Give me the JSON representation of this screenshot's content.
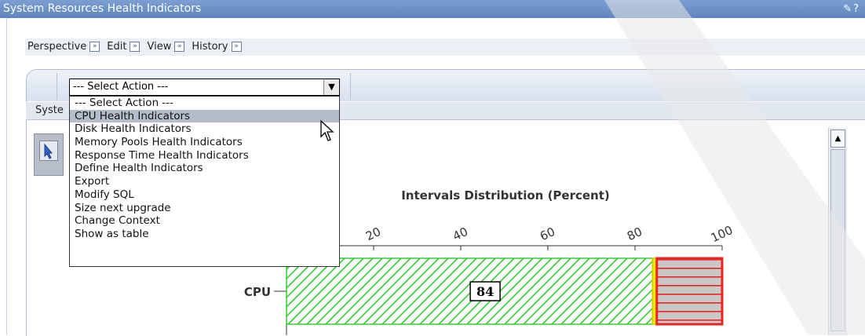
{
  "window": {
    "title": "System Resources Health Indicators",
    "edit_icon": "pencil-icon",
    "help_icon": "question-icon"
  },
  "menubar": {
    "items": [
      {
        "label": "Perspective"
      },
      {
        "label": "Edit"
      },
      {
        "label": "View"
      },
      {
        "label": "History"
      }
    ]
  },
  "action_select": {
    "value": "--- Select Action ---"
  },
  "tabs": {
    "partial_label": "Syste"
  },
  "action_menu": {
    "selected_index": 1,
    "options": [
      "--- Select Action ---",
      "CPU Health Indicators",
      "Disk Health Indicators",
      "Memory Pools Health Indicators",
      "Response Time Health Indicators",
      "Define Health Indicators",
      "Export",
      "Modify SQL",
      "Size next upgrade",
      "Change Context",
      "Show as table"
    ]
  },
  "chart_data": {
    "type": "bar",
    "orientation": "horizontal",
    "stacked": true,
    "title": "Intervals Distribution (Percent)",
    "categories": [
      "CPU"
    ],
    "x_tick_labels": [
      "20",
      "40",
      "60",
      "80",
      "100"
    ],
    "xlim": [
      0,
      100
    ],
    "series": [
      {
        "values": [
          84
        ],
        "color": "#33cc33",
        "pattern": "diagonal-hatch"
      },
      {
        "values": [
          1
        ],
        "color": "#e8e800"
      },
      {
        "values": [
          15
        ],
        "color": "#ee2222",
        "pattern": "horizontal-hatch"
      }
    ],
    "data_labels": [
      "84"
    ]
  }
}
